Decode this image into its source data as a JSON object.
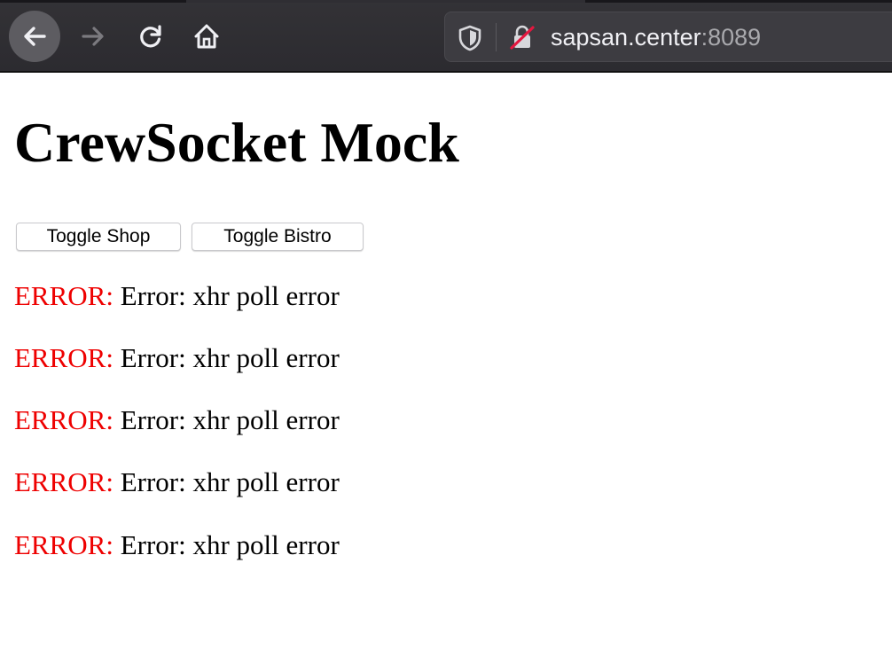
{
  "browser": {
    "url_host": "sapsan.center",
    "url_port": ":8089"
  },
  "page": {
    "title": "CrewSocket Mock",
    "buttons": {
      "toggle_shop": "Toggle Shop",
      "toggle_bistro": "Toggle Bistro"
    },
    "log": [
      {
        "label": "ERROR:",
        "message": " Error: xhr poll error"
      },
      {
        "label": "ERROR:",
        "message": " Error: xhr poll error"
      },
      {
        "label": "ERROR:",
        "message": " Error: xhr poll error"
      },
      {
        "label": "ERROR:",
        "message": " Error: xhr poll error"
      },
      {
        "label": "ERROR:",
        "message": " Error: xhr poll error"
      }
    ]
  },
  "colors": {
    "error": "#ee0000",
    "toolbar": "#2b2a33"
  },
  "icons": [
    "back-arrow-icon",
    "forward-arrow-icon",
    "reload-icon",
    "home-icon",
    "tracking-shield-icon",
    "insecure-lock-icon"
  ]
}
